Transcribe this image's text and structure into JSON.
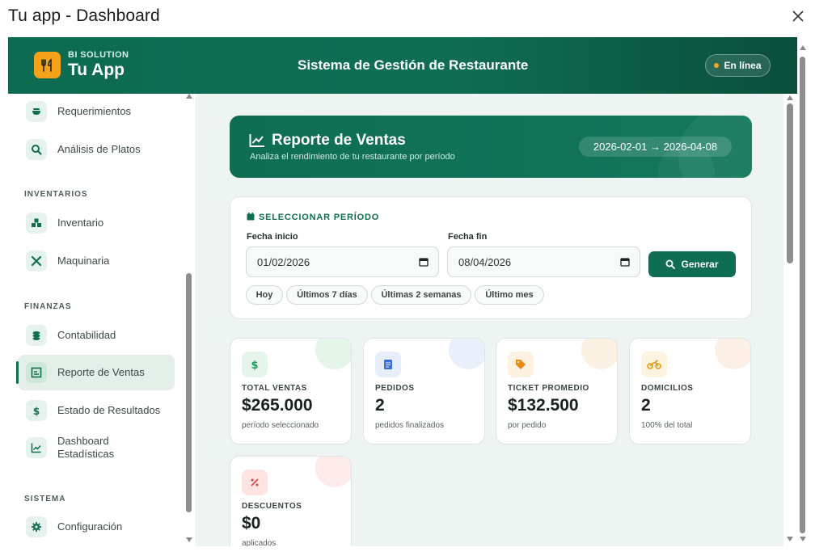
{
  "window": {
    "title": "Tu app - Dashboard"
  },
  "header": {
    "brand_sub": "BI SOLUTION",
    "brand_name": "Tu App",
    "title": "Sistema de Gestión de Restaurante",
    "status": "En línea"
  },
  "sidebar": {
    "items_top": [
      {
        "label": "Requerimientos",
        "icon": "bowl-icon"
      },
      {
        "label": "Análisis de Platos",
        "icon": "magnifier-icon"
      }
    ],
    "sections": [
      {
        "title": "INVENTARIOS",
        "items": [
          {
            "label": "Inventario",
            "icon": "boxes-icon"
          },
          {
            "label": "Maquinaria",
            "icon": "tools-icon"
          }
        ]
      },
      {
        "title": "FINANZAS",
        "items": [
          {
            "label": "Contabilidad",
            "icon": "coins-icon"
          },
          {
            "label": "Reporte de Ventas",
            "icon": "report-icon",
            "active": true
          },
          {
            "label": "Estado de Resultados",
            "icon": "dollar-icon"
          },
          {
            "label": "Dashboard Estadísticas",
            "icon": "chart-line-icon"
          }
        ]
      },
      {
        "title": "SISTEMA",
        "items": [
          {
            "label": "Configuración",
            "icon": "gear-icon"
          }
        ]
      }
    ]
  },
  "banner": {
    "title": "Reporte de Ventas",
    "subtitle": "Analiza el rendimiento de tu restaurante por período",
    "date_range": "2026-02-01 → 2026-04-08"
  },
  "period": {
    "title": "SELECCIONAR PERÍODO",
    "start_label": "Fecha inicio",
    "start_value": "01/02/2026",
    "end_label": "Fecha fin",
    "end_value": "08/04/2026",
    "generate": "Generar",
    "quick": [
      "Hoy",
      "Últimos 7 días",
      "Últimas 2 semanas",
      "Último mes"
    ]
  },
  "stats": [
    {
      "label": "TOTAL VENTAS",
      "value": "$265.000",
      "note": "período seleccionado",
      "icon": "dollar-icon",
      "color": "#1c9e5a",
      "bg": "#e5f5ec",
      "blob": "#e6f5ea"
    },
    {
      "label": "PEDIDOS",
      "value": "2",
      "note": "pedidos finalizados",
      "icon": "receipt-icon",
      "color": "#3d6fd8",
      "bg": "#e6eefc",
      "blob": "#e9effb"
    },
    {
      "label": "TICKET PROMEDIO",
      "value": "$132.500",
      "note": "por pedido",
      "icon": "tag-icon",
      "color": "#e88a14",
      "bg": "#fdf1e0",
      "blob": "#fcf2e4"
    },
    {
      "label": "DOMICILIOS",
      "value": "2",
      "note": "100% del total",
      "icon": "motorcycle-icon",
      "color": "#e09a10",
      "bg": "#fdf3df",
      "blob": "#fcefe6"
    },
    {
      "label": "DESCUENTOS",
      "value": "$0",
      "note": "aplicados",
      "icon": "percent-icon",
      "color": "#d9443a",
      "bg": "#fde3e1",
      "blob": "#fcebea"
    }
  ]
}
